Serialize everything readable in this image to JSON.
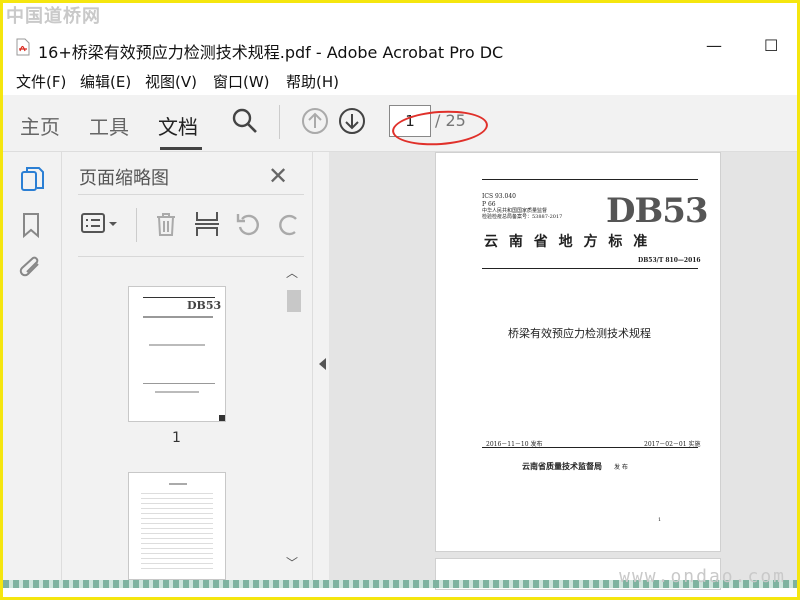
{
  "watermark": {
    "top_left": "中国道桥网",
    "bottom_right": "www.ondao.com"
  },
  "window": {
    "title": "16+桥梁有效预应力检测技术规程.pdf - Adobe Acrobat Pro DC",
    "minimize": "—",
    "maximize": "☐"
  },
  "menu": {
    "items": [
      "文件(F)",
      "编辑(E)",
      "视图(V)",
      "窗口(W)",
      "帮助(H)"
    ]
  },
  "toolbar": {
    "tabs": [
      "主页",
      "工具",
      "文档"
    ],
    "active_tab": "文档",
    "page_current": "1",
    "page_total": "/ 25"
  },
  "panel": {
    "title": "页面缩略图",
    "close": "✕",
    "thumb1_label": "1"
  },
  "document": {
    "ics": "ICS 93.040",
    "p": "P 66",
    "reg1": "中华人民共和国国家质量监督",
    "reg2": "检验检疫总局备案号：53887-2017",
    "badge": "DB53",
    "province": "云 南 省 地 方 标 准",
    "code": "DB53/T 810—2016",
    "title": "桥梁有效预应力检测技术规程",
    "issued": "2016－11－10 发布",
    "effective": "2017－02－01 实施",
    "issuer": "云南省质量技术监督局",
    "issuer_suffix": "发 布",
    "page_no": "1"
  },
  "colors": {
    "annotation": "#e0302a",
    "pdf_red": "#d9261c",
    "accent_blue": "#2b7fd4"
  }
}
